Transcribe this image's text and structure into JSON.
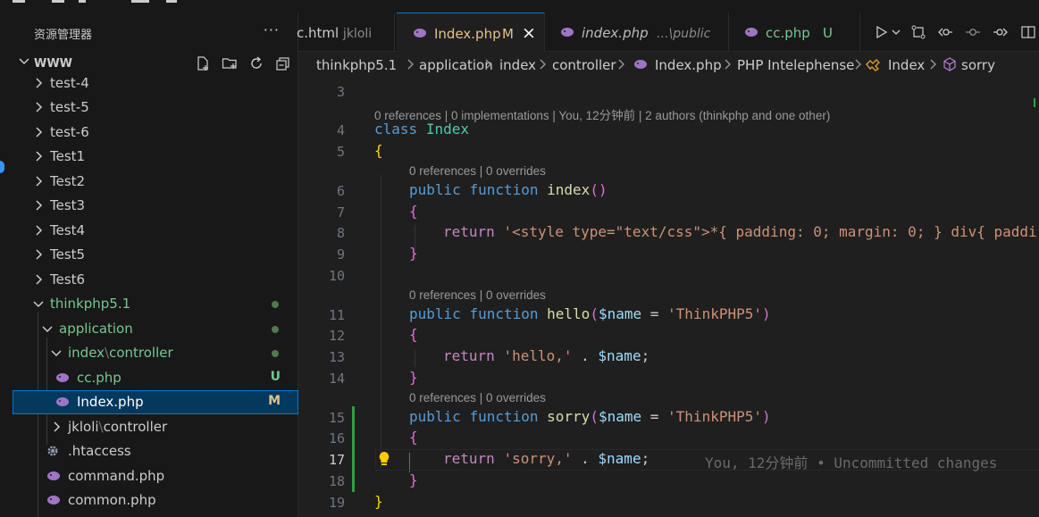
{
  "colors": {
    "accent": "#0078d4",
    "git_added": "#73c991",
    "git_modified": "#e2c08d",
    "selection": "#04395e"
  },
  "sidebar": {
    "title": "资源管理器",
    "more": "···",
    "root": "WWW",
    "actions": [
      "new-file-icon",
      "new-folder-icon",
      "refresh-icon",
      "collapse-all-icon"
    ],
    "items": [
      {
        "label": "test-4"
      },
      {
        "label": "test-5"
      },
      {
        "label": "test-6"
      },
      {
        "label": "Test1"
      },
      {
        "label": "Test2"
      },
      {
        "label": "Test3"
      },
      {
        "label": "Test4"
      },
      {
        "label": "Test5"
      },
      {
        "label": "Test6"
      },
      {
        "label": "thinkphp5.1"
      },
      {
        "label": "application"
      },
      {
        "label": "index",
        "sep": "\\",
        "label2": "controller"
      },
      {
        "label": "cc.php",
        "badge": "U"
      },
      {
        "label": "Index.php",
        "badge": "M"
      },
      {
        "label": "jkloli",
        "sep": "\\",
        "label2": "controller"
      },
      {
        "label": ".htaccess"
      },
      {
        "label": "command.php"
      },
      {
        "label": "common.php"
      }
    ]
  },
  "tabs": [
    {
      "label": "c.html",
      "hint": "jkloli"
    },
    {
      "label": "Index.php",
      "badge": "M",
      "close": "×"
    },
    {
      "label": "index.php",
      "hint": "...\\public"
    },
    {
      "label": "cc.php",
      "badge": "U"
    }
  ],
  "breadcrumb": [
    "thinkphp5.1",
    "application",
    "index",
    "controller",
    "Index.php",
    "PHP Intelephense",
    "Index",
    "sorry"
  ],
  "editor": {
    "lens_class": "0 references | 0 implementations | You, 12分钟前 | 2 authors (thinkphp and one other)",
    "lens_method": "0 references | 0 overrides",
    "blame": "You, 12分钟前 • Uncommitted changes",
    "line_numbers": [
      "3",
      "4",
      "5",
      "6",
      "7",
      "8",
      "9",
      "10",
      "11",
      "12",
      "13",
      "14",
      "15",
      "16",
      "17",
      "18",
      "19"
    ],
    "current_line": "17",
    "code": {
      "class_kw": "class",
      "class_name": "Index",
      "open_brace": "{",
      "close_brace": "}",
      "public": "public",
      "function": "function",
      "return": "return",
      "index_name": "index",
      "index_parens": "()",
      "index_return_str": "'<style type=\"text/css\">*{ padding: 0; margin: 0; } div{ paddi",
      "hello_name": "hello",
      "sorry_name": "sorry",
      "param_var": "$name",
      "param_eq": " = ",
      "param_default": "'ThinkPHP5'",
      "hello_str": "'hello,'",
      "sorry_str": "'sorry,'",
      "concat": " . ",
      "semicolon": ";"
    }
  }
}
